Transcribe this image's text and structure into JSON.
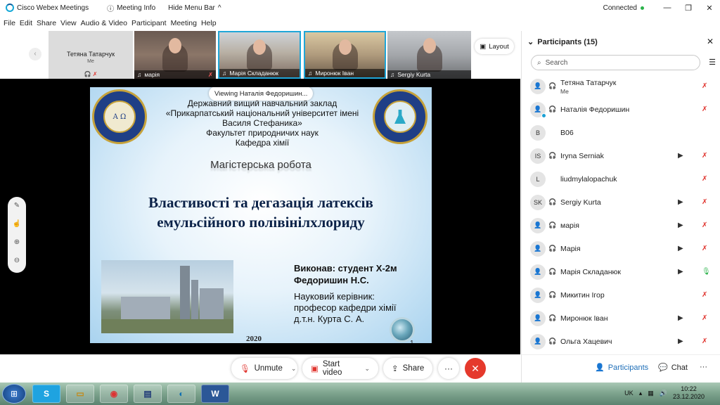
{
  "titlebar": {
    "app_name": "Cisco Webex Meetings",
    "meeting_info": "Meeting Info",
    "hide_menu": "Hide Menu Bar",
    "status": "Connected"
  },
  "menu": [
    "File",
    "Edit",
    "Share",
    "View",
    "Audio & Video",
    "Participant",
    "Meeting",
    "Help"
  ],
  "strip": {
    "self_name": "Тетяна Татарчук",
    "self_tag": "Me",
    "tiles": [
      "марія",
      "Марія Складанюк",
      "Миронюк Іван",
      "Sergiy Kurta"
    ],
    "layout_label": "Layout"
  },
  "slide": {
    "viewing": "Viewing Наталія Федоришин...",
    "lines": [
      "Державний вищий навчальний заклад",
      "«Прикарпатський національний університет імені",
      "Василя Стефаника»",
      "Факультет природничих наук",
      "Кафедра хімії"
    ],
    "master": "Магістерська робота",
    "title_1": "Властивості та дегазація латексів",
    "title_2": "емульсійного полівінілхлориду",
    "author_1": "Виконав: студент Х-2м",
    "author_2": "Федоришин Н.С.",
    "sup_1": "Науковий керівник:",
    "sup_2": "професор кафедри хімії",
    "sup_3": "д.т.н. Курта С. А.",
    "year": "2020",
    "page": "1"
  },
  "controls": {
    "mute": "Unmute",
    "video": "Start video",
    "share": "Share",
    "more": "···",
    "end": "✕",
    "participants": "Participants",
    "chat": "Chat"
  },
  "panel": {
    "title": "Participants (15)",
    "search_placeholder": "Search",
    "participants": [
      {
        "initials": "",
        "name": "Тетяна Татарчук",
        "sub": "Me",
        "cam": false,
        "mic": "muted"
      },
      {
        "initials": "",
        "name": "Наталія Федоришин",
        "sub": "",
        "cam": false,
        "mic": "muted"
      },
      {
        "initials": "B",
        "name": "B06",
        "sub": "",
        "cam": false,
        "mic": "none"
      },
      {
        "initials": "IS",
        "name": "Iryna Serniak",
        "sub": "",
        "cam": true,
        "mic": "muted"
      },
      {
        "initials": "L",
        "name": "liudmylalopachuk",
        "sub": "",
        "cam": false,
        "mic": "muted"
      },
      {
        "initials": "SK",
        "name": "Sergiy Kurta",
        "sub": "",
        "cam": true,
        "mic": "muted"
      },
      {
        "initials": "",
        "name": "марія",
        "sub": "",
        "cam": true,
        "mic": "muted"
      },
      {
        "initials": "",
        "name": "Марія",
        "sub": "",
        "cam": true,
        "mic": "muted"
      },
      {
        "initials": "",
        "name": "Марія Складанюк",
        "sub": "",
        "cam": true,
        "mic": "on"
      },
      {
        "initials": "",
        "name": "Микитин Ігор",
        "sub": "",
        "cam": false,
        "mic": "muted"
      },
      {
        "initials": "",
        "name": "Миронюк Іван",
        "sub": "",
        "cam": true,
        "mic": "muted"
      },
      {
        "initials": "",
        "name": "Ольга Хацевич",
        "sub": "",
        "cam": true,
        "mic": "muted"
      }
    ]
  },
  "taskbar": {
    "lang": "UK",
    "time": "10:22",
    "date": "23.12.2020"
  }
}
